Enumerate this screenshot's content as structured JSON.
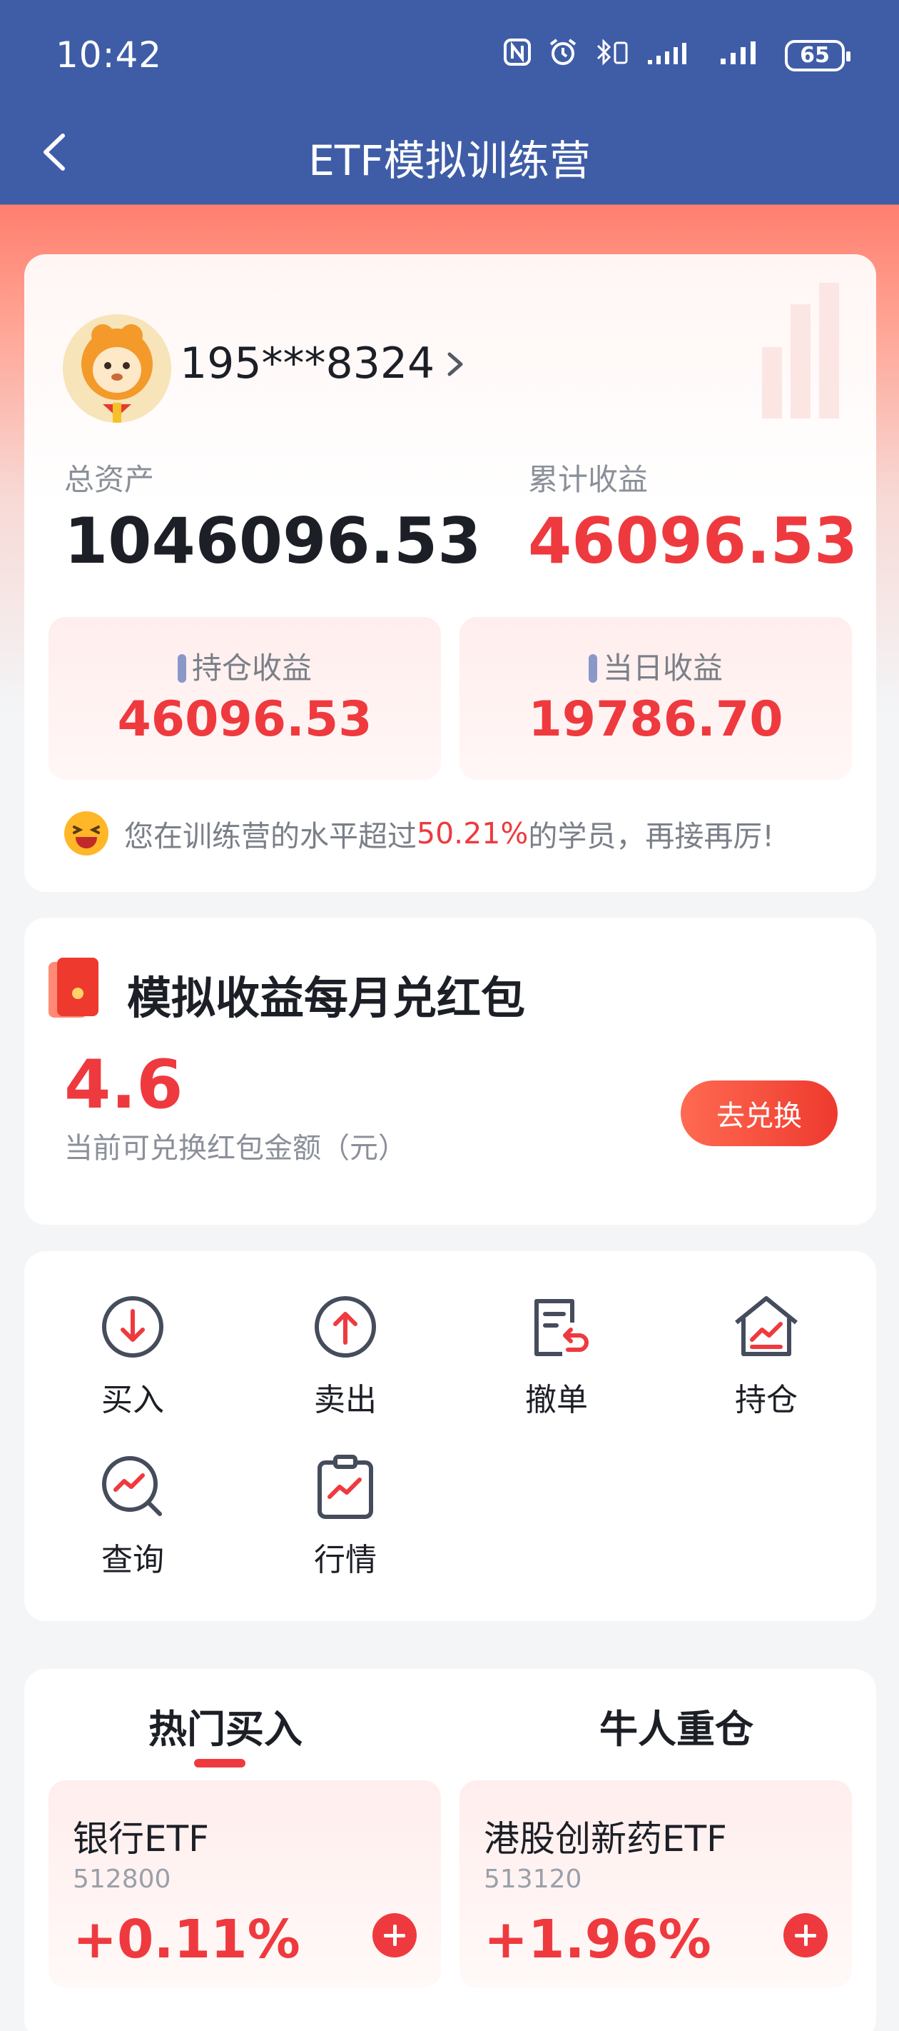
{
  "status_bar": {
    "time": "10:42",
    "battery": "65"
  },
  "nav": {
    "title": "ETF模拟训练营"
  },
  "account": {
    "phone": "195***8324",
    "total_assets_label": "总资产",
    "total_assets": "1046096.53",
    "cumulative_income_label": "累计收益",
    "cumulative_income": "46096.53",
    "holding_income_label": "持仓收益",
    "holding_income": "46096.53",
    "daily_income_label": "当日收益",
    "daily_income": "19786.70",
    "tip_prefix": "您在训练营的水平超过",
    "tip_percent": "50.21%",
    "tip_suffix": "的学员，再接再厉!"
  },
  "red_packet": {
    "title": "模拟收益每月兑红包",
    "amount": "4.6",
    "amount_label": "当前可兑换红包金额（元）",
    "exchange_button": "去兑换"
  },
  "actions": [
    {
      "label": "买入",
      "icon": "buy-icon"
    },
    {
      "label": "卖出",
      "icon": "sell-icon"
    },
    {
      "label": "撤单",
      "icon": "cancel-order-icon"
    },
    {
      "label": "持仓",
      "icon": "holdings-icon"
    },
    {
      "label": "查询",
      "icon": "query-icon"
    },
    {
      "label": "行情",
      "icon": "market-icon"
    }
  ],
  "tabs": [
    {
      "label": "热门买入",
      "active": true
    },
    {
      "label": "牛人重仓",
      "active": false
    }
  ],
  "funds": [
    {
      "name": "银行ETF",
      "code": "512800",
      "change": "+0.11%"
    },
    {
      "name": "港股创新药ETF",
      "code": "513120",
      "change": "+1.96%"
    }
  ],
  "colors": {
    "primary_blue": "#3f5da7",
    "accent_red": "#ee3a3e",
    "coral": "#ff7f6e"
  }
}
